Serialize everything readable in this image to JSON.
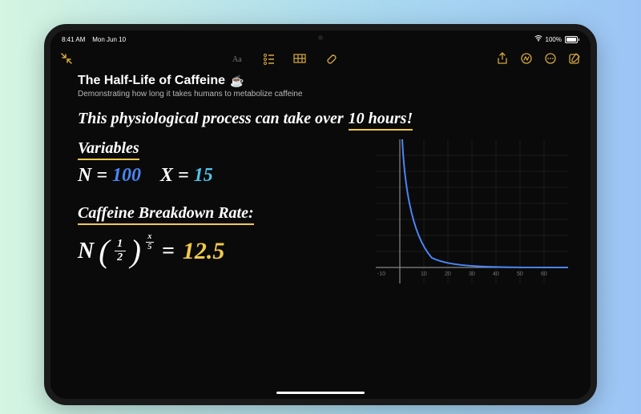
{
  "status": {
    "time": "8:41 AM",
    "date": "Mon Jun 10",
    "wifi": "100%"
  },
  "note": {
    "title": "The Half-Life of Caffeine",
    "cup_emoji": "☕️",
    "subtitle": "Demonstrating how long it takes humans to metabolize caffeine"
  },
  "handwriting": {
    "line1_a": "This physiological process can take over",
    "line1_b": "10 hours!",
    "variables_header": "Variables",
    "n_label": "N =",
    "n_value": "100",
    "x_label": "X =",
    "x_value": "15",
    "breakdown_header": "Caffeine Breakdown Rate:",
    "formula_N": "N",
    "frac_top": "1",
    "frac_bot": "2",
    "exp_top": "x",
    "exp_bot": "5",
    "equals": "=",
    "result": "12.5"
  },
  "chart_data": {
    "type": "line",
    "xlim": [
      -10,
      60
    ],
    "ylim": [
      0,
      100
    ],
    "x_ticks": [
      -10,
      10,
      20,
      30,
      40,
      50,
      60
    ],
    "curve": "exponential-decay",
    "series": [
      {
        "name": "caffeine",
        "color": "#4a86f7"
      }
    ]
  },
  "colors": {
    "accent": "#d4a842",
    "highlight": "#f2c94c",
    "blue": "#4a86f7",
    "cyan": "#4fc3e8"
  }
}
